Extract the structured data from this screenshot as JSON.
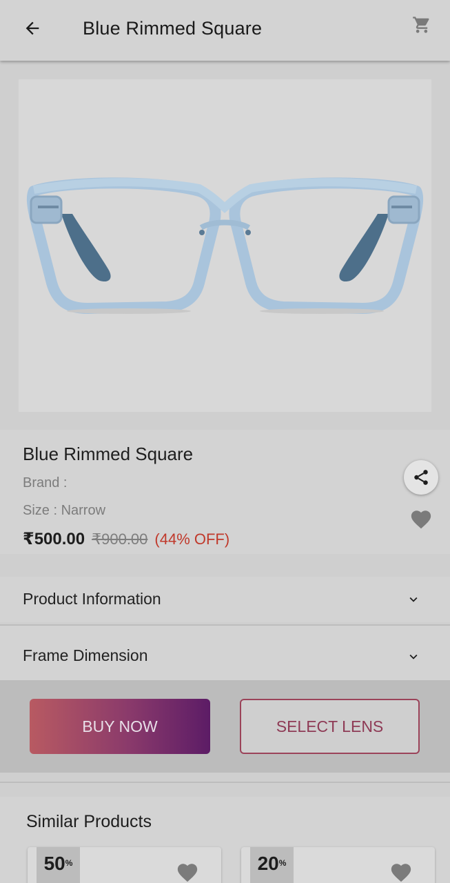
{
  "appbar": {
    "title": "Blue Rimmed Square",
    "back_icon": "arrow-left-icon",
    "cart_icon": "cart-icon"
  },
  "product": {
    "name": "Blue Rimmed Square",
    "brand": "Brand :",
    "size": "Size : Narrow",
    "price": "₹500.00",
    "original_price": "₹900.00",
    "discount": "(44% OFF)",
    "frame_color": "#a9c4dc"
  },
  "accordions": [
    {
      "label": "Product Information"
    },
    {
      "label": "Frame Dimension"
    }
  ],
  "actions": {
    "buy_now": "BUY NOW",
    "select_lens": "SELECT LENS"
  },
  "similar": {
    "heading": "Similar Products",
    "items": [
      {
        "discount_num": "50",
        "discount_unit": "%"
      },
      {
        "discount_num": "20",
        "discount_unit": "%"
      }
    ]
  },
  "colors": {
    "discount": "#c0392b",
    "accent_gradient_start": "#b85a62",
    "accent_gradient_end": "#5c1c66",
    "outline_button": "#9b4359"
  }
}
